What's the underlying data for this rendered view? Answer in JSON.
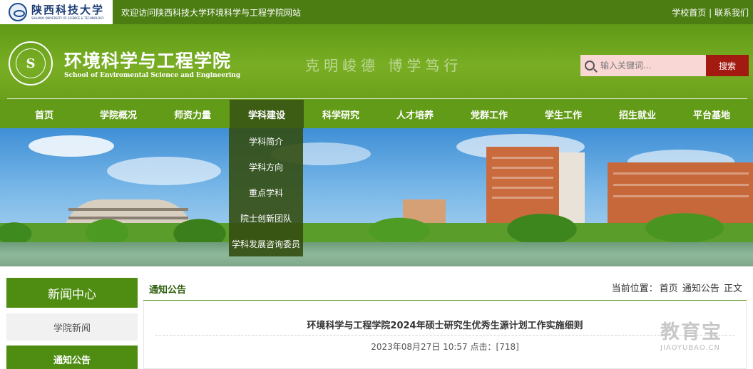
{
  "topbar": {
    "university_name": "陕西科技大学",
    "university_name_en": "SHAANXI UNIVERSITY OF SCIENCE & TECHNOLOGY",
    "welcome": "欢迎访问陕西科技大学环境科学与工程学院网站",
    "link_home": "学校首页",
    "separator": " | ",
    "link_contact": "联系我们"
  },
  "header": {
    "title_cn": "环境科学与工程学院",
    "title_en": "School of Enviromental Science and Engineering",
    "motto": "克明峻德  博学笃行",
    "seal_letter": "S",
    "search_placeholder": "输入关键词...",
    "search_button": "搜索"
  },
  "nav": {
    "items": [
      {
        "label": "首页"
      },
      {
        "label": "学院概况"
      },
      {
        "label": "师资力量"
      },
      {
        "label": "学科建设"
      },
      {
        "label": "科学研究"
      },
      {
        "label": "人才培养"
      },
      {
        "label": "党群工作"
      },
      {
        "label": "学生工作"
      },
      {
        "label": "招生就业"
      },
      {
        "label": "平台基地"
      }
    ],
    "active_index": 3
  },
  "dropdown": {
    "items": [
      {
        "label": "学科简介"
      },
      {
        "label": "学科方向"
      },
      {
        "label": "重点学科"
      },
      {
        "label": "院士创新团队"
      },
      {
        "label": "学科发展咨询委员"
      }
    ]
  },
  "sidebar": {
    "title": "新闻中心",
    "items": [
      {
        "label": "学院新闻",
        "active": false
      },
      {
        "label": "通知公告",
        "active": true
      }
    ]
  },
  "content": {
    "section_title": "通知公告",
    "breadcrumb_prefix": "当前位置：",
    "breadcrumb": [
      "首页",
      "通知公告",
      "正文"
    ],
    "article_title": "环境科学与工程学院2024年硕士研究生优秀生源计划工作实施细则",
    "article_date": "2023年08月27日 10:57",
    "clicks_label": "点击：",
    "clicks_value": "[718]"
  },
  "watermark": {
    "text": "教育宝",
    "domain": "JIAOYUBAO.CN"
  },
  "colors": {
    "topbar": "#4b7d12",
    "nav": "#629b17",
    "nav_active": "#3d5d14",
    "search_button": "#a31a10",
    "sidebar_green": "#4f8d12"
  }
}
